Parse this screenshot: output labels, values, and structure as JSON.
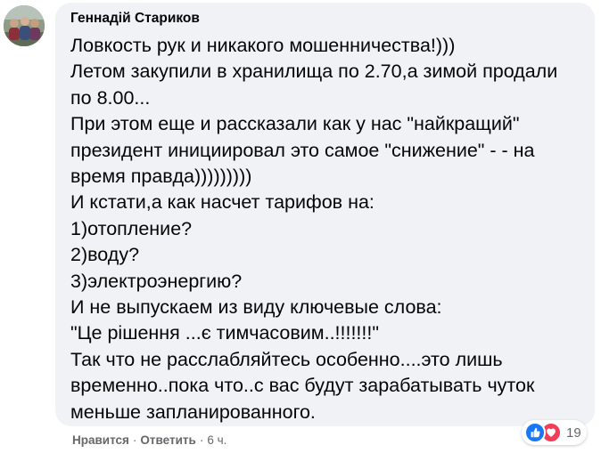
{
  "comment": {
    "author": "Геннадій Стариков",
    "text_lines": [
      "Ловкость рук и никакого мошенничества!)))",
      "Летом закупили в хранилища по 2.70,а зимой продали",
      "по 8.00...",
      "При этом еще и рассказали как у нас \"найкращий\"",
      "президент инициировал это самое \"снижение\" - - на",
      "время правда)))))))))",
      "И кстати,а как насчет тарифов на:",
      "1)отопление?",
      "2)воду?",
      "3)электроэнергию?",
      "И не выпускаем из виду ключевые слова:",
      "\"Це рішення ...є тимчасовим..!!!!!!!\"",
      "Так что не расслабляйтесь особенно....это лишь",
      "временно..пока что..с вас будут зарабатывать чуток",
      "меньше запланированного."
    ]
  },
  "reactions": {
    "icons": [
      "like-icon",
      "love-icon"
    ],
    "count": "19",
    "colors": {
      "like": "#1877f2",
      "love": "#f33e58"
    }
  },
  "actions": {
    "like_label": "Нравится",
    "separator": "·",
    "reply_label": "Ответить",
    "timestamp": "6 ч."
  },
  "colors": {
    "bubble_background": "#f0f2f5",
    "text": "#050505",
    "secondary_text": "#65676b"
  }
}
